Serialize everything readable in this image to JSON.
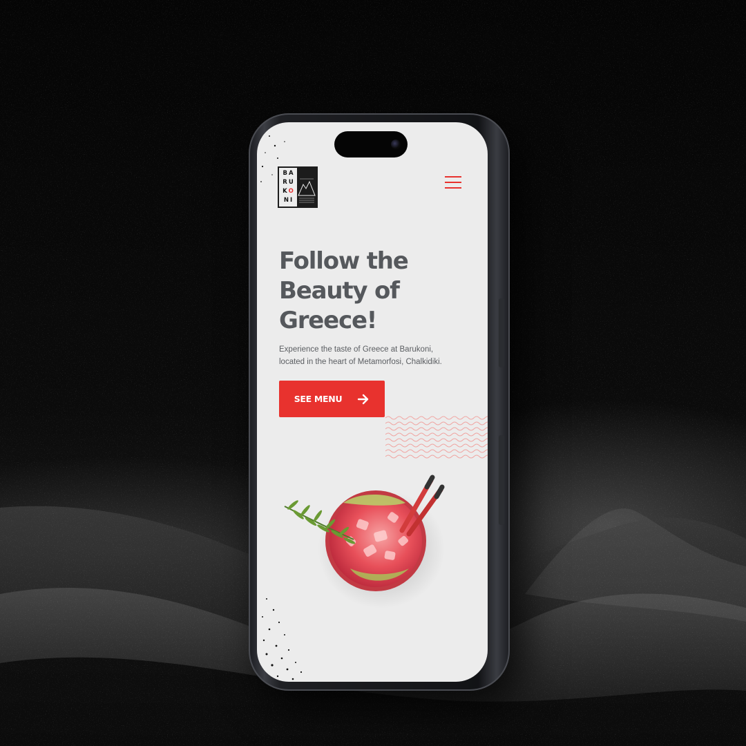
{
  "logo": {
    "letters": [
      "B",
      "A",
      "R",
      "U",
      "K",
      "O",
      "N",
      "I"
    ],
    "alt": "Barukoni logo"
  },
  "nav": {
    "menu_icon": "hamburger-menu-icon"
  },
  "hero": {
    "title": "Follow the Beauty of Greece!",
    "subtitle": "Experience the taste of Greece at Barukoni, located in the heart of Metamorfosi, Chalkidiki.",
    "cta_label": "SEE MENU",
    "cta_icon": "arrow-right-icon"
  },
  "colors": {
    "accent": "#e8322e",
    "heading": "#55585c",
    "screen_bg": "#ececec",
    "scene_bg": "#060606"
  }
}
